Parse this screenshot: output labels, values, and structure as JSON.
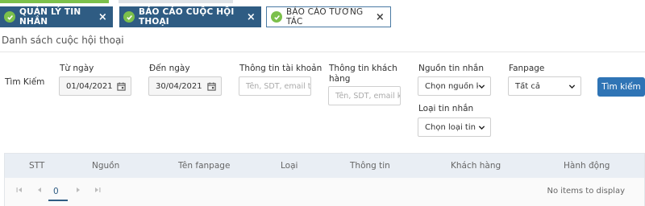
{
  "tabs": [
    {
      "label": "QUẢN LÝ TIN NHẮN"
    },
    {
      "label": "BÁO CÁO CUỘC HỘI THOẠI"
    },
    {
      "label": "BÁO CÁO TƯƠNG TÁC"
    }
  ],
  "close_glyph": "×",
  "page_title": "Danh sách cuộc hội thoại",
  "search": {
    "label": "Tìm Kiếm",
    "from_date_label": "Từ ngày",
    "from_date_value": "01/04/2021",
    "to_date_label": "Đến ngày",
    "to_date_value": "30/04/2021",
    "account_label": "Thông tin tài khoản",
    "account_placeholder": "Tên, SDT, email tài",
    "customer_label": "Thông tin khách hàng",
    "customer_placeholder": "Tên, SDT, email khá",
    "source_label": "Nguồn tin nhắn",
    "source_value": "Chọn nguồn khá",
    "fanpage_label": "Fanpage",
    "fanpage_value": "Tất cả",
    "type_label": "Loại tin nhắn",
    "type_value": "Chọn loại tin nh",
    "button_label": "Tìm kiếm"
  },
  "grid": {
    "columns": [
      "STT",
      "Nguồn",
      "Tên fanpage",
      "Loại",
      "Thông tin",
      "Khách hàng",
      "Hành động"
    ],
    "pager": {
      "page": "0",
      "empty_text": "No items to display"
    }
  },
  "colors": {
    "tab_active": "#2f5c83",
    "check": "#7cc04b",
    "button": "#2f74b5",
    "grid_header": "#e9eef4"
  }
}
